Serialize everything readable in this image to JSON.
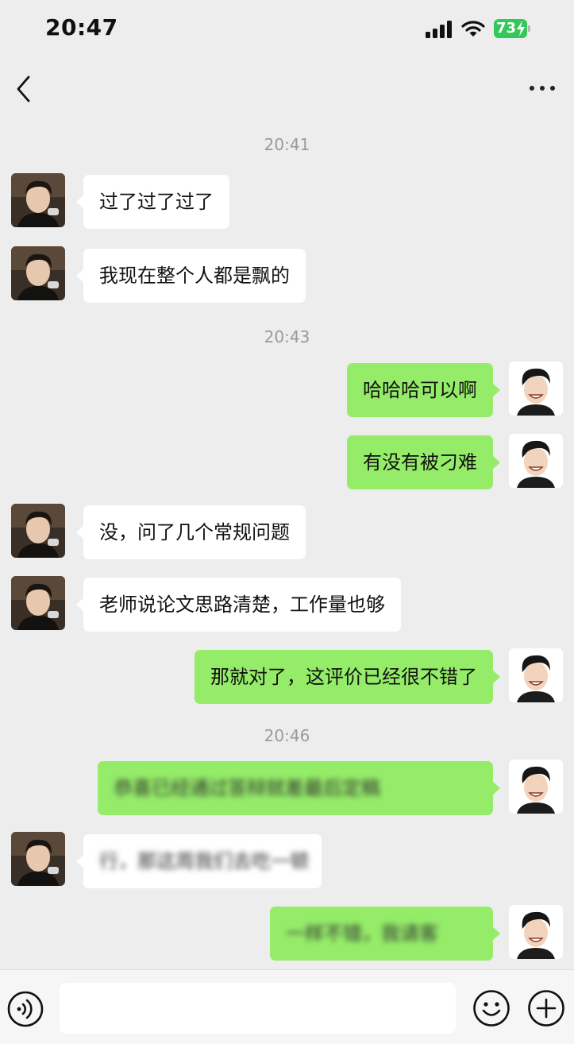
{
  "status_bar": {
    "time": "20:47",
    "battery": "73"
  },
  "header": {
    "title": ""
  },
  "input": {
    "placeholder": ""
  },
  "timestamps": [
    "20:41",
    "20:43",
    "20:46"
  ],
  "messages": [
    {
      "side": "in",
      "text": "过了过了过了",
      "blurred": false
    },
    {
      "side": "in",
      "text": "我现在整个人都是飘的",
      "blurred": false
    },
    {
      "side": "out",
      "text": "哈哈哈可以啊",
      "blurred": false
    },
    {
      "side": "out",
      "text": "有没有被刁难",
      "blurred": false
    },
    {
      "side": "in",
      "text": "没，问了几个常规问题",
      "blurred": false
    },
    {
      "side": "in",
      "text": "老师说论文思路清楚，工作量也够",
      "blurred": false
    },
    {
      "side": "out",
      "text": "那就对了，这评价已经很不错了",
      "blurred": false
    },
    {
      "side": "out",
      "text": "恭喜已经通过答辩就差最后定稿",
      "blurred": true
    },
    {
      "side": "in",
      "text": "行，那这周我们去吃一顿",
      "blurred": true
    },
    {
      "side": "out",
      "text": "一样不错，我请客",
      "blurred": true
    }
  ],
  "colors": {
    "incoming_bubble": "#ffffff",
    "outgoing_bubble": "#95ec69",
    "background": "#ededed",
    "battery": "#34c759"
  }
}
